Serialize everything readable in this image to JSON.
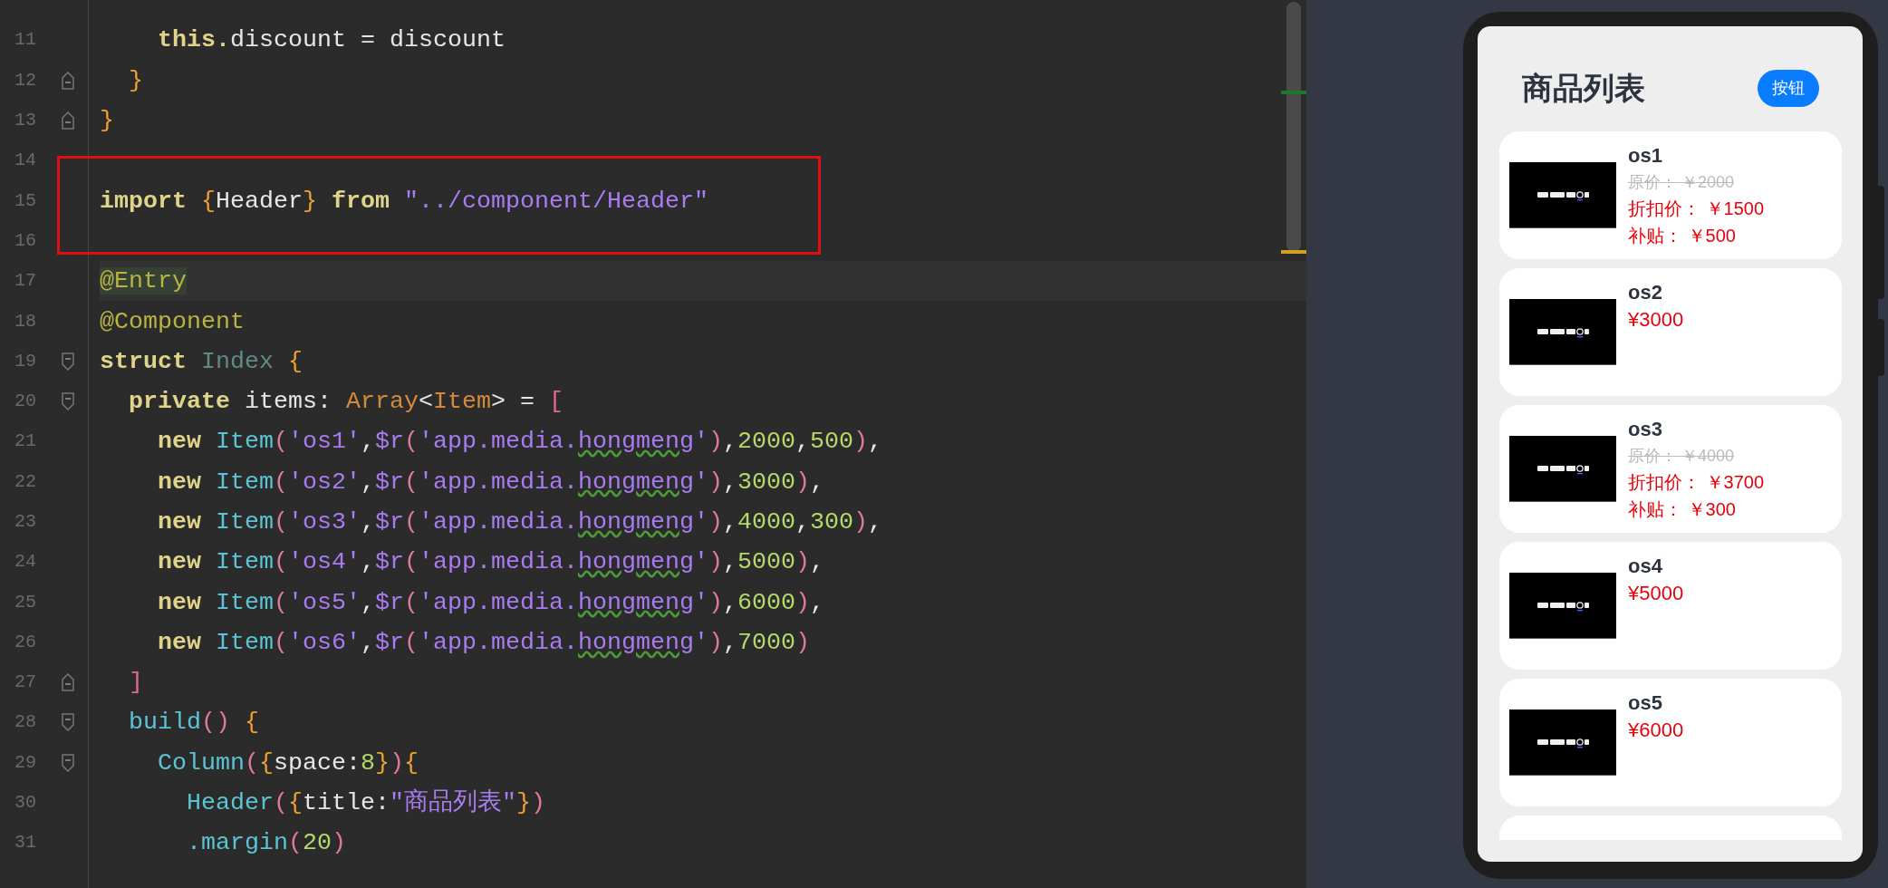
{
  "editor": {
    "lines": [
      {
        "number": "11",
        "tokens": [
          {
            "text": "    this.",
            "kind": "keyword"
          },
          {
            "text": "discount = discount",
            "kind": "plain"
          }
        ]
      },
      {
        "number": "12",
        "fold_end": true,
        "tokens": [
          {
            "text": "  }",
            "kind": "brace"
          }
        ]
      },
      {
        "number": "13",
        "fold_end": true,
        "tokens": [
          {
            "text": "}",
            "kind": "brace"
          }
        ]
      },
      {
        "number": "14",
        "boxed": true
      },
      {
        "number": "15",
        "boxed": true,
        "tokens": [
          {
            "text": "import ",
            "kind": "keyword"
          },
          {
            "text": "{",
            "kind": "brace"
          },
          {
            "text": "Header",
            "kind": "plain"
          },
          {
            "text": "} ",
            "kind": "brace"
          },
          {
            "text": "from ",
            "kind": "keyword"
          },
          {
            "text": "\"../component/Header\"",
            "kind": "string"
          }
        ]
      },
      {
        "number": "16",
        "boxed": true
      },
      {
        "number": "17",
        "current": true,
        "tokens": [
          {
            "text": "@Entry",
            "kind": "annotation_marked"
          }
        ]
      },
      {
        "number": "18",
        "tokens": [
          {
            "text": "@Component",
            "kind": "annotation"
          }
        ]
      },
      {
        "number": "19",
        "fold_start": true,
        "tokens": [
          {
            "text": "struct ",
            "kind": "keyword"
          },
          {
            "text": "Index ",
            "kind": "class"
          },
          {
            "text": "{",
            "kind": "brace"
          }
        ]
      },
      {
        "number": "20",
        "fold_start": true,
        "tokens": [
          {
            "text": "  private",
            "kind": "keyword"
          },
          {
            "text": " items: ",
            "kind": "plain"
          },
          {
            "text": "Array",
            "kind": "type"
          },
          {
            "text": "<",
            "kind": "plain"
          },
          {
            "text": "Item",
            "kind": "type"
          },
          {
            "text": "> = ",
            "kind": "plain"
          },
          {
            "text": "[",
            "kind": "bracket"
          }
        ]
      },
      {
        "number": "21",
        "tokens": [
          {
            "text": "    new ",
            "kind": "keyword"
          },
          {
            "text": "Item",
            "kind": "call"
          },
          {
            "text": "(",
            "kind": "paren"
          },
          {
            "text": "'os1'",
            "kind": "string"
          },
          {
            "text": ",",
            "kind": "plain"
          },
          {
            "text": "$r",
            "kind": "string"
          },
          {
            "text": "(",
            "kind": "paren"
          },
          {
            "text": "'app.media.",
            "kind": "string"
          },
          {
            "text": "hongmeng",
            "kind": "string_warn"
          },
          {
            "text": "'",
            "kind": "string"
          },
          {
            "text": ")",
            "kind": "paren"
          },
          {
            "text": ",",
            "kind": "plain"
          },
          {
            "text": "2000",
            "kind": "number"
          },
          {
            "text": ",",
            "kind": "plain"
          },
          {
            "text": "500",
            "kind": "number"
          },
          {
            "text": ")",
            "kind": "paren"
          },
          {
            "text": ",",
            "kind": "plain"
          }
        ]
      },
      {
        "number": "22",
        "tokens": [
          {
            "text": "    new ",
            "kind": "keyword"
          },
          {
            "text": "Item",
            "kind": "call"
          },
          {
            "text": "(",
            "kind": "paren"
          },
          {
            "text": "'os2'",
            "kind": "string"
          },
          {
            "text": ",",
            "kind": "plain"
          },
          {
            "text": "$r",
            "kind": "string"
          },
          {
            "text": "(",
            "kind": "paren"
          },
          {
            "text": "'app.media.",
            "kind": "string"
          },
          {
            "text": "hongmeng",
            "kind": "string_warn"
          },
          {
            "text": "'",
            "kind": "string"
          },
          {
            "text": ")",
            "kind": "paren"
          },
          {
            "text": ",",
            "kind": "plain"
          },
          {
            "text": "3000",
            "kind": "number"
          },
          {
            "text": ")",
            "kind": "paren"
          },
          {
            "text": ",",
            "kind": "plain"
          }
        ]
      },
      {
        "number": "23",
        "tokens": [
          {
            "text": "    new ",
            "kind": "keyword"
          },
          {
            "text": "Item",
            "kind": "call"
          },
          {
            "text": "(",
            "kind": "paren"
          },
          {
            "text": "'os3'",
            "kind": "string"
          },
          {
            "text": ",",
            "kind": "plain"
          },
          {
            "text": "$r",
            "kind": "string"
          },
          {
            "text": "(",
            "kind": "paren"
          },
          {
            "text": "'app.media.",
            "kind": "string"
          },
          {
            "text": "hongmeng",
            "kind": "string_warn"
          },
          {
            "text": "'",
            "kind": "string"
          },
          {
            "text": ")",
            "kind": "paren"
          },
          {
            "text": ",",
            "kind": "plain"
          },
          {
            "text": "4000",
            "kind": "number"
          },
          {
            "text": ",",
            "kind": "plain"
          },
          {
            "text": "300",
            "kind": "number"
          },
          {
            "text": ")",
            "kind": "paren"
          },
          {
            "text": ",",
            "kind": "plain"
          }
        ]
      },
      {
        "number": "24",
        "tokens": [
          {
            "text": "    new ",
            "kind": "keyword"
          },
          {
            "text": "Item",
            "kind": "call"
          },
          {
            "text": "(",
            "kind": "paren"
          },
          {
            "text": "'os4'",
            "kind": "string"
          },
          {
            "text": ",",
            "kind": "plain"
          },
          {
            "text": "$r",
            "kind": "string"
          },
          {
            "text": "(",
            "kind": "paren"
          },
          {
            "text": "'app.media.",
            "kind": "string"
          },
          {
            "text": "hongmeng",
            "kind": "string_warn"
          },
          {
            "text": "'",
            "kind": "string"
          },
          {
            "text": ")",
            "kind": "paren"
          },
          {
            "text": ",",
            "kind": "plain"
          },
          {
            "text": "5000",
            "kind": "number"
          },
          {
            "text": ")",
            "kind": "paren"
          },
          {
            "text": ",",
            "kind": "plain"
          }
        ]
      },
      {
        "number": "25",
        "tokens": [
          {
            "text": "    new ",
            "kind": "keyword"
          },
          {
            "text": "Item",
            "kind": "call"
          },
          {
            "text": "(",
            "kind": "paren"
          },
          {
            "text": "'os5'",
            "kind": "string"
          },
          {
            "text": ",",
            "kind": "plain"
          },
          {
            "text": "$r",
            "kind": "string"
          },
          {
            "text": "(",
            "kind": "paren"
          },
          {
            "text": "'app.media.",
            "kind": "string"
          },
          {
            "text": "hongmeng",
            "kind": "string_warn"
          },
          {
            "text": "'",
            "kind": "string"
          },
          {
            "text": ")",
            "kind": "paren"
          },
          {
            "text": ",",
            "kind": "plain"
          },
          {
            "text": "6000",
            "kind": "number"
          },
          {
            "text": ")",
            "kind": "paren"
          },
          {
            "text": ",",
            "kind": "plain"
          }
        ]
      },
      {
        "number": "26",
        "tokens": [
          {
            "text": "    new ",
            "kind": "keyword"
          },
          {
            "text": "Item",
            "kind": "call"
          },
          {
            "text": "(",
            "kind": "paren"
          },
          {
            "text": "'os6'",
            "kind": "string"
          },
          {
            "text": ",",
            "kind": "plain"
          },
          {
            "text": "$r",
            "kind": "string"
          },
          {
            "text": "(",
            "kind": "paren"
          },
          {
            "text": "'app.media.",
            "kind": "string"
          },
          {
            "text": "hongmeng",
            "kind": "string_warn"
          },
          {
            "text": "'",
            "kind": "string"
          },
          {
            "text": ")",
            "kind": "paren"
          },
          {
            "text": ",",
            "kind": "plain"
          },
          {
            "text": "7000",
            "kind": "number"
          },
          {
            "text": ")",
            "kind": "paren"
          }
        ]
      },
      {
        "number": "27",
        "fold_end": true,
        "tokens": [
          {
            "text": "  ]",
            "kind": "bracket"
          }
        ]
      },
      {
        "number": "28",
        "fold_start": true,
        "tokens": [
          {
            "text": "  build",
            "kind": "call"
          },
          {
            "text": "() ",
            "kind": "paren"
          },
          {
            "text": "{",
            "kind": "brace"
          }
        ]
      },
      {
        "number": "29",
        "fold_start": true,
        "tokens": [
          {
            "text": "    Column",
            "kind": "call"
          },
          {
            "text": "(",
            "kind": "paren"
          },
          {
            "text": "{",
            "kind": "brace"
          },
          {
            "text": "space:",
            "kind": "plain"
          },
          {
            "text": "8",
            "kind": "number"
          },
          {
            "text": "}",
            "kind": "brace"
          },
          {
            "text": ")",
            "kind": "paren"
          },
          {
            "text": "{",
            "kind": "brace"
          }
        ]
      },
      {
        "number": "30",
        "tokens": [
          {
            "text": "      Header",
            "kind": "call"
          },
          {
            "text": "(",
            "kind": "paren"
          },
          {
            "text": "{",
            "kind": "brace"
          },
          {
            "text": "title:",
            "kind": "plain"
          },
          {
            "text": "\"商品列表\"",
            "kind": "string"
          },
          {
            "text": "}",
            "kind": "brace"
          },
          {
            "text": ")",
            "kind": "paren"
          }
        ]
      },
      {
        "number": "31",
        "tokens": [
          {
            "text": "      .margin",
            "kind": "call"
          },
          {
            "text": "(",
            "kind": "paren"
          },
          {
            "text": "20",
            "kind": "number"
          },
          {
            "text": ")",
            "kind": "paren"
          }
        ]
      }
    ]
  },
  "phone": {
    "header": {
      "title": "商品列表",
      "button": "按钮"
    },
    "products": [
      {
        "name": "os1",
        "kind": "discount",
        "original": "原价： ￥2000",
        "discount": "折扣价： ￥1500",
        "subsidy": "补贴： ￥500"
      },
      {
        "name": "os2",
        "kind": "plain",
        "price": "¥3000"
      },
      {
        "name": "os3",
        "kind": "discount",
        "original": "原价： ￥4000",
        "discount": "折扣价： ￥3700",
        "subsidy": "补贴： ￥300"
      },
      {
        "name": "os4",
        "kind": "plain",
        "price": "¥5000"
      },
      {
        "name": "os5",
        "kind": "plain",
        "price": "¥6000"
      },
      {
        "kind": "partial"
      }
    ]
  }
}
